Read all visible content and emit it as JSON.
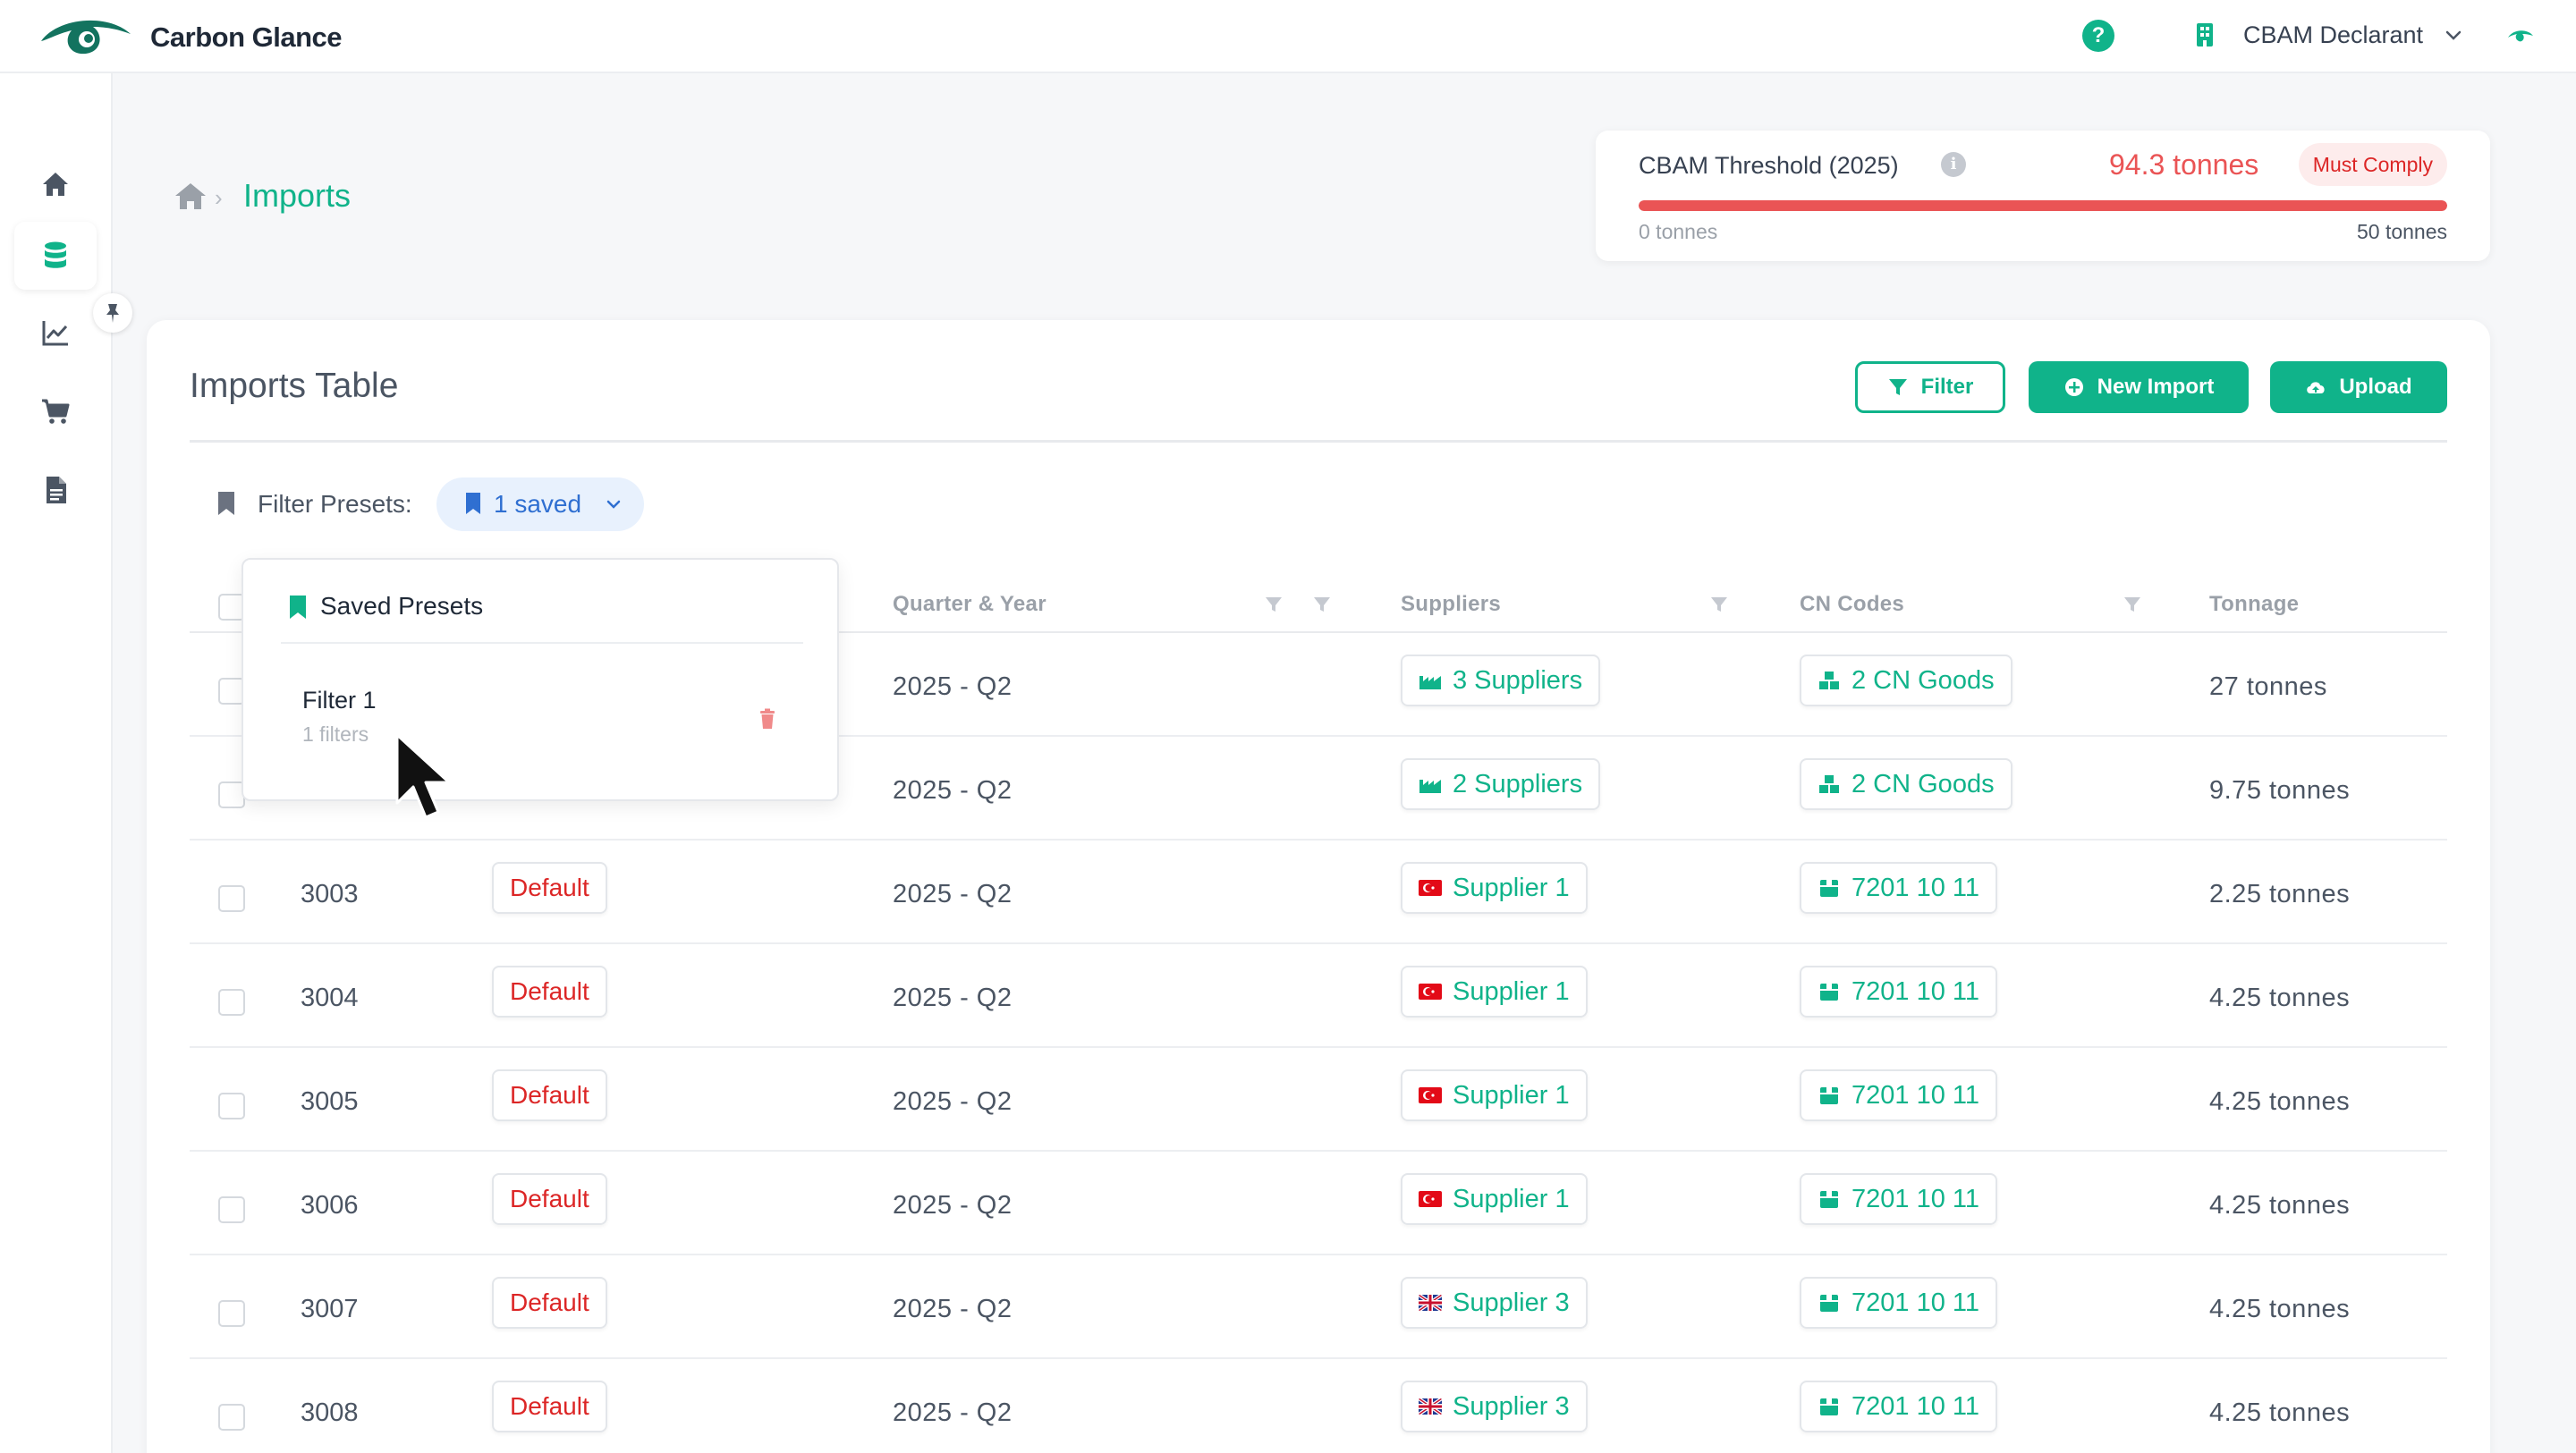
{
  "app": {
    "name": "Carbon Glance",
    "colors": {
      "accent": "#10b38a",
      "danger": "#dc2626",
      "link": "#2f6fd1"
    }
  },
  "header": {
    "help_icon": "question-circle-icon",
    "help_label": "?",
    "account_name": "CBAM Declarant"
  },
  "sidebar": {
    "items": [
      {
        "icon": "home-icon",
        "label": "Home"
      },
      {
        "icon": "database-icon",
        "label": "Imports",
        "active": true
      },
      {
        "icon": "chart-line-icon",
        "label": "Analytics"
      },
      {
        "icon": "cart-icon",
        "label": "Purchases"
      },
      {
        "icon": "document-icon",
        "label": "Reports"
      }
    ]
  },
  "breadcrumb": {
    "current": "Imports",
    "separator": "›"
  },
  "threshold": {
    "title": "CBAM Threshold (2025)",
    "info_label": "i",
    "value": "94.3 tonnes",
    "badge": "Must Comply",
    "min_label": "0 tonnes",
    "max_label": "50 tonnes",
    "fill_fraction": 1.0
  },
  "main": {
    "title": "Imports Table",
    "buttons": {
      "filter": "Filter",
      "new_import": "New Import",
      "upload": "Upload"
    },
    "filter_presets": {
      "label": "Filter Presets:",
      "chip": "1 saved"
    }
  },
  "table": {
    "columns": {
      "quarter": "Quarter & Year",
      "suppliers": "Suppliers",
      "cn_codes": "CN Codes",
      "tonnage": "Tonnage"
    },
    "rows": [
      {
        "id": "",
        "status": "",
        "quarter": "2025 - Q2",
        "supplier": "3 Suppliers",
        "supplier_icon": "factory-icon",
        "cn": "2 CN Goods",
        "cn_icon": "boxes-icon",
        "tonnage": "27 tonnes"
      },
      {
        "id": "",
        "status": "",
        "quarter": "2025 - Q2",
        "supplier": "2 Suppliers",
        "supplier_icon": "factory-icon",
        "cn": "2 CN Goods",
        "cn_icon": "boxes-icon",
        "tonnage": "9.75 tonnes"
      },
      {
        "id": "3003",
        "status": "Default",
        "quarter": "2025 - Q2",
        "supplier": "Supplier 1",
        "supplier_icon": "turkey-flag-icon",
        "cn": "7201 10 11",
        "cn_icon": "box-icon",
        "tonnage": "2.25 tonnes"
      },
      {
        "id": "3004",
        "status": "Default",
        "quarter": "2025 - Q2",
        "supplier": "Supplier 1",
        "supplier_icon": "turkey-flag-icon",
        "cn": "7201 10 11",
        "cn_icon": "box-icon",
        "tonnage": "4.25 tonnes"
      },
      {
        "id": "3005",
        "status": "Default",
        "quarter": "2025 - Q2",
        "supplier": "Supplier 1",
        "supplier_icon": "turkey-flag-icon",
        "cn": "7201 10 11",
        "cn_icon": "box-icon",
        "tonnage": "4.25 tonnes"
      },
      {
        "id": "3006",
        "status": "Default",
        "quarter": "2025 - Q2",
        "supplier": "Supplier 1",
        "supplier_icon": "turkey-flag-icon",
        "cn": "7201 10 11",
        "cn_icon": "box-icon",
        "tonnage": "4.25 tonnes"
      },
      {
        "id": "3007",
        "status": "Default",
        "quarter": "2025 - Q2",
        "supplier": "Supplier 3",
        "supplier_icon": "uk-flag-icon",
        "cn": "7201 10 11",
        "cn_icon": "box-icon",
        "tonnage": "4.25 tonnes"
      },
      {
        "id": "3008",
        "status": "Default",
        "quarter": "2025 - Q2",
        "supplier": "Supplier 3",
        "supplier_icon": "uk-flag-icon",
        "cn": "7201 10 11",
        "cn_icon": "box-icon",
        "tonnage": "4.25 tonnes"
      }
    ]
  },
  "presets_dropdown": {
    "title": "Saved Presets",
    "items": [
      {
        "name": "Filter 1",
        "count": "1 filters"
      }
    ]
  }
}
